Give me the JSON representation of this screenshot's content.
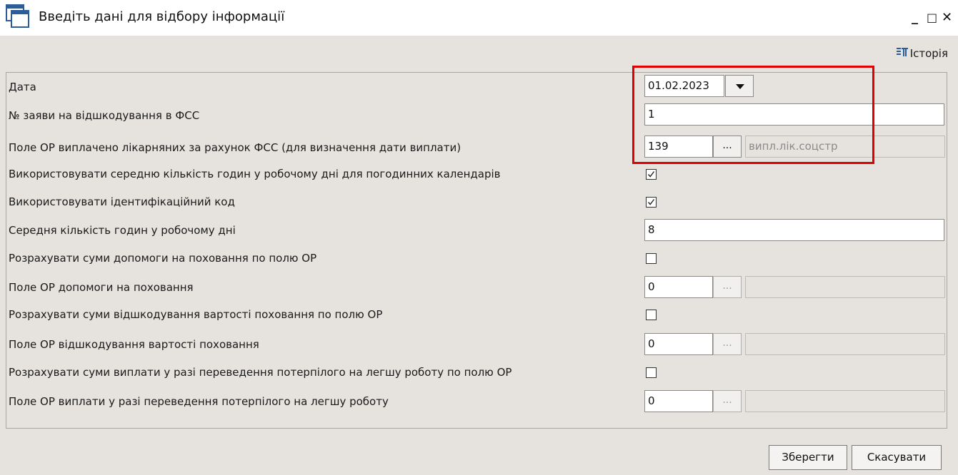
{
  "window": {
    "title": "Введіть дані для відбору інформації",
    "minimize_glyph": "_",
    "maximize_glyph": "□",
    "close_glyph": "✕"
  },
  "toolbar": {
    "history_label": "Історія"
  },
  "form": {
    "rows": [
      {
        "label": "Дата"
      },
      {
        "label": "№ заяви на відшкодування в ФСС"
      },
      {
        "label": "Поле ОР виплачено лікарняних за рахунок ФСС (для визначення дати виплати)"
      },
      {
        "label": "Використовувати середню кількість годин у робочому дні для погодинних календарів"
      },
      {
        "label": "Використовувати ідентифікаційний код"
      },
      {
        "label": "Середня кількість годин у робочому дні"
      },
      {
        "label": "Розрахувати суми допомоги на поховання по полю ОР"
      },
      {
        "label": "Поле ОР допомоги на поховання"
      },
      {
        "label": "Розрахувати суми відшкодування вартості поховання по полю ОР"
      },
      {
        "label": "Поле ОР відшкодування вартості поховання"
      },
      {
        "label": "Розрахувати суми виплати у разі переведення потерпілого на легшу роботу по полю ОР"
      },
      {
        "label": "Поле ОР виплати у разі переведення потерпілого на легшу роботу"
      }
    ],
    "date_value": "01.02.2023",
    "claim_number": "1",
    "sick_field_code": "139",
    "sick_field_name": "випл.лік.соцстр",
    "use_avg_hours": true,
    "use_id_code": true,
    "avg_hours": "8",
    "calc_burial_aid": false,
    "burial_aid_code": "0",
    "burial_aid_name": "",
    "calc_burial_cost": false,
    "burial_cost_code": "0",
    "burial_cost_name": "",
    "calc_light_work": false,
    "light_work_code": "0",
    "light_work_name": "",
    "ellipsis": "..."
  },
  "buttons": {
    "save": "Зберегти",
    "cancel": "Скасувати"
  },
  "colors": {
    "highlight": "#e00000",
    "background": "#e6e3de"
  }
}
